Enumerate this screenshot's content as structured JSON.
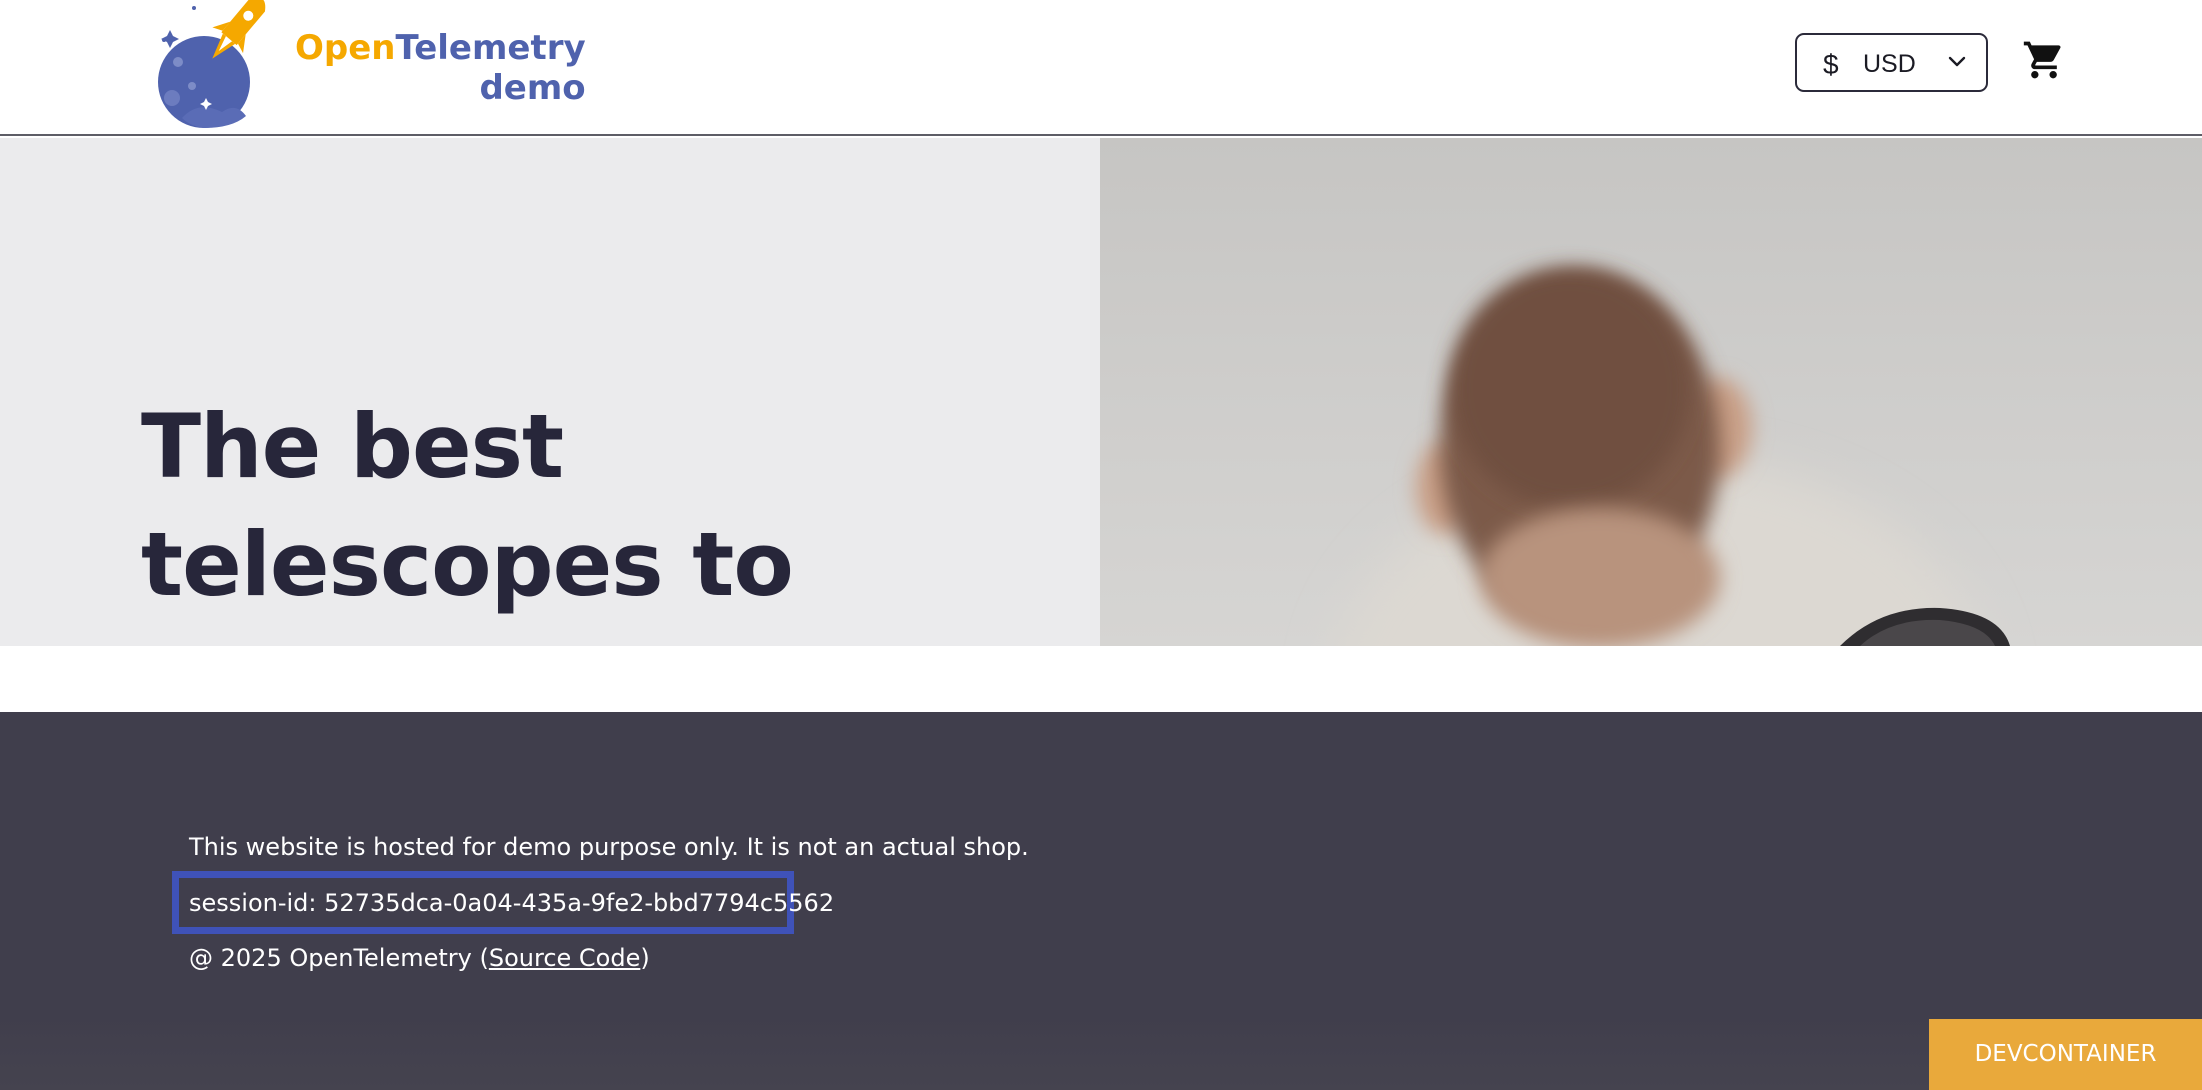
{
  "header": {
    "logo": {
      "word_open": "Open",
      "word_telemetry": "Telemetry",
      "word_demo": "demo",
      "brand_colors": {
        "orange": "#f5a800",
        "blue": "#4f62ad"
      }
    },
    "currency": {
      "symbol": "$",
      "selected": "USD",
      "icon": "chevron-down-icon"
    },
    "cart": {
      "icon": "shopping-cart-icon"
    }
  },
  "hero": {
    "title": "The best telescopes to see the world closer",
    "background_left": "#ebebed"
  },
  "footer": {
    "disclaimer": "This website is hosted for demo purpose only. It is not an actual shop.",
    "session_label": "session-id: ",
    "session_id": "52735dca-0a04-435a-9fe2-bbd7794c5562",
    "copyright_prefix": "@ 2025 OpenTelemetry (",
    "source_link": "Source Code",
    "copyright_suffix": ")",
    "highlight_color": "#3f52b8"
  },
  "devcontainer_badge": "DEVCONTAINER"
}
